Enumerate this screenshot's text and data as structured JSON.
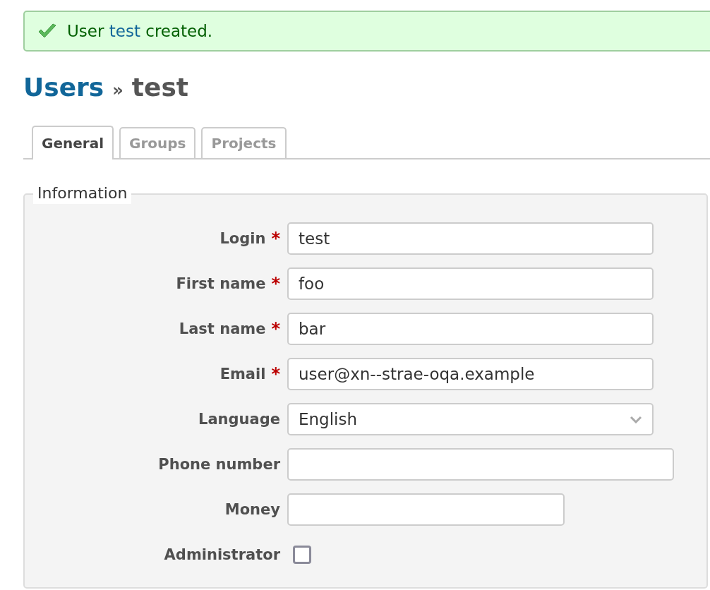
{
  "flash": {
    "before": "User ",
    "link": "test",
    "after": " created."
  },
  "title": {
    "parent": "Users",
    "separator": "»",
    "current": "test"
  },
  "tabs": [
    {
      "label": "General",
      "selected": true
    },
    {
      "label": "Groups",
      "selected": false
    },
    {
      "label": "Projects",
      "selected": false
    }
  ],
  "fieldset": {
    "legend": "Information",
    "fields": [
      {
        "kind": "text",
        "label": "Login",
        "required": true,
        "value": "test"
      },
      {
        "kind": "text",
        "label": "First name",
        "required": true,
        "value": "foo"
      },
      {
        "kind": "text",
        "label": "Last name",
        "required": true,
        "value": "bar"
      },
      {
        "kind": "text",
        "label": "Email",
        "required": true,
        "value": "user@xn--strae-oqa.example"
      },
      {
        "kind": "select",
        "label": "Language",
        "required": false,
        "value": "English"
      },
      {
        "kind": "text",
        "label": "Phone number",
        "required": false
      },
      {
        "kind": "text",
        "label": "Money",
        "required": false
      },
      {
        "kind": "checkbox",
        "label": "Administrator",
        "required": false,
        "checked": false
      }
    ]
  },
  "required_mark": "*"
}
